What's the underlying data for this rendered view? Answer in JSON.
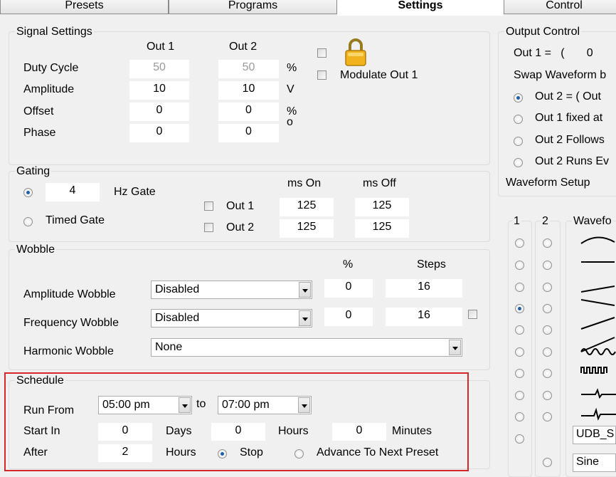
{
  "tabs": [
    "Presets",
    "Programs",
    "Settings",
    "Control"
  ],
  "signal": {
    "title": "Signal Settings",
    "out1_header": "Out 1",
    "out2_header": "Out 2",
    "rows": [
      {
        "label": "Duty Cycle",
        "out1": "50",
        "out2": "50",
        "unit": "%"
      },
      {
        "label": "Amplitude",
        "out1": "10",
        "out2": "10",
        "unit": "V"
      },
      {
        "label": "Offset",
        "out1": "0",
        "out2": "0",
        "unit": "%"
      },
      {
        "label": "Phase",
        "out1": "0",
        "out2": "0",
        "unit": "o"
      }
    ],
    "modulate_label": "Modulate Out 1"
  },
  "gating": {
    "title": "Gating",
    "hz_value": "4",
    "hz_label": "Hz Gate",
    "timed_label": "Timed Gate",
    "ms_on_header": "ms On",
    "ms_off_header": "ms Off",
    "outputs": [
      {
        "label": "Out 1",
        "on": "125",
        "off": "125"
      },
      {
        "label": "Out 2",
        "on": "125",
        "off": "125"
      }
    ]
  },
  "wobble": {
    "title": "Wobble",
    "pct_header": "%",
    "steps_header": "Steps",
    "amplitude": {
      "label": "Amplitude Wobble",
      "mode": "Disabled",
      "pct": "0",
      "steps": "16"
    },
    "frequency": {
      "label": "Frequency Wobble",
      "mode": "Disabled",
      "pct": "0",
      "steps": "16"
    },
    "harmonic": {
      "label": "Harmonic Wobble",
      "mode": "None"
    }
  },
  "schedule": {
    "title": "Schedule",
    "run_from_label": "Run From",
    "from_time": "05:00 pm",
    "to_label": "to",
    "to_time": "07:00 pm",
    "start_in_label": "Start In",
    "days_value": "0",
    "days_label": "Days",
    "hours_value": "0",
    "hours_label": "Hours",
    "minutes_value": "0",
    "minutes_label": "Minutes",
    "after_label": "After",
    "after_value": "2",
    "after_unit": "Hours",
    "stop_label": "Stop",
    "advance_label": "Advance To Next Preset"
  },
  "output_control": {
    "title": "Output Control",
    "out1_line": "Out 1 =   (       0",
    "swap_label": "Swap Waveform b",
    "options": [
      "Out 2 = ( Out",
      "Out 1 fixed at",
      "Out 2 Follows",
      "Out 2 Runs Ev"
    ]
  },
  "waveform": {
    "title": "Waveform Setup",
    "col1": "1",
    "col2": "2",
    "col3": "Wavefo",
    "udb_value": "UDB_S",
    "sine_value": "Sine"
  },
  "colors": {
    "highlight": "#d62828",
    "radio_on": "#1f5fa8"
  }
}
